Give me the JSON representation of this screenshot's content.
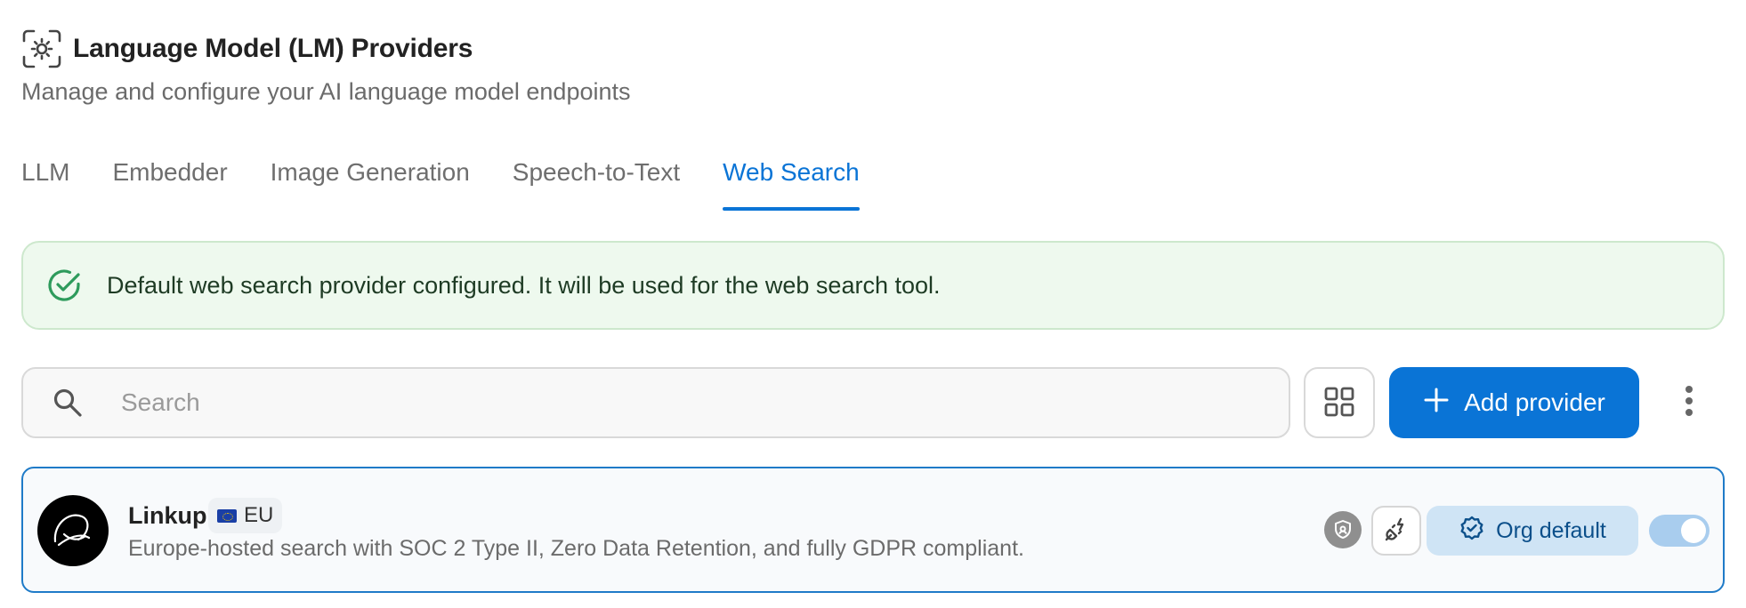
{
  "header": {
    "title": "Language Model (LM) Providers",
    "subtitle": "Manage and configure your AI language model endpoints",
    "icon": "settings-gear-icon"
  },
  "tabs": [
    {
      "label": "LLM",
      "active": false
    },
    {
      "label": "Embedder",
      "active": false
    },
    {
      "label": "Image Generation",
      "active": false
    },
    {
      "label": "Speech-to-Text",
      "active": false
    },
    {
      "label": "Web Search",
      "active": true
    }
  ],
  "alert": {
    "text": "Default web search provider configured. It will be used for the web search tool.",
    "icon": "check-circle-icon",
    "color": "#2e9b5c"
  },
  "toolbar": {
    "search_placeholder": "Search",
    "search_value": "",
    "add_label": "Add provider",
    "accent": "#0a74d6"
  },
  "provider": {
    "name": "Linkup",
    "region": "EU",
    "description": "Europe-hosted search with SOC 2 Type II, Zero Data Retention, and fully GDPR compliant.",
    "default_label": "Org default",
    "enabled": true
  }
}
